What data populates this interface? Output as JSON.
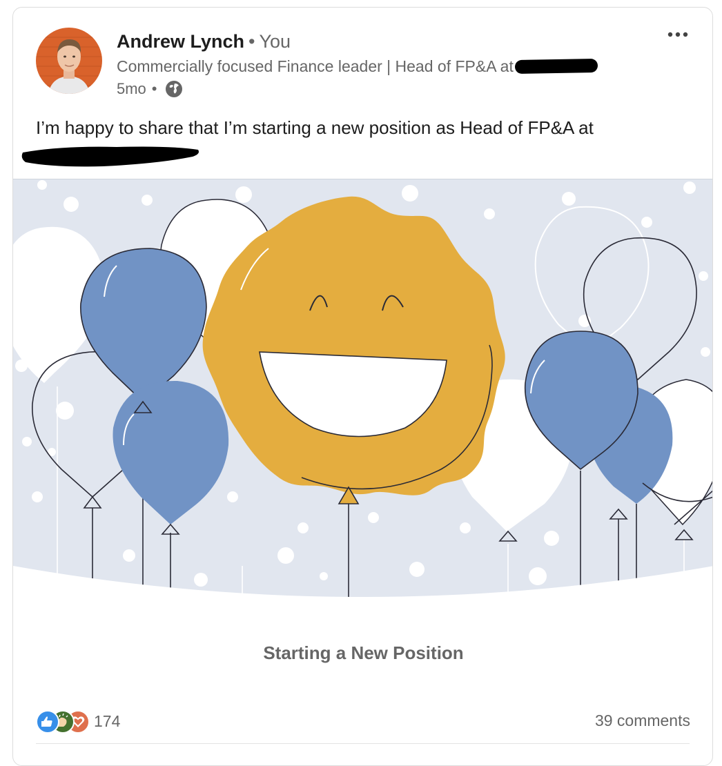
{
  "post": {
    "author": {
      "name": "Andrew Lynch",
      "separator": "•",
      "connection": "You",
      "headline": "Commercially focused Finance leader | Head of FP&A at",
      "time": "5mo",
      "meta_separator": "•",
      "visibility_icon": "globe-icon",
      "avatar_bg": "#d9622b"
    },
    "more_icon": "more-horizontal-icon",
    "body_text": "I’m happy to share that I’m starting a new position as Head of FP&A at",
    "hero": {
      "caption": "Starting a New Position",
      "colors": {
        "background": "#e1e6ef",
        "blue_balloon": "#7193c5",
        "sun": "#e4ad3f",
        "outline": "#2a2a36"
      }
    },
    "social": {
      "reaction_count": "174",
      "reaction_icons": [
        "like-icon",
        "celebrate-icon",
        "love-icon"
      ],
      "comments": "39 comments"
    }
  }
}
